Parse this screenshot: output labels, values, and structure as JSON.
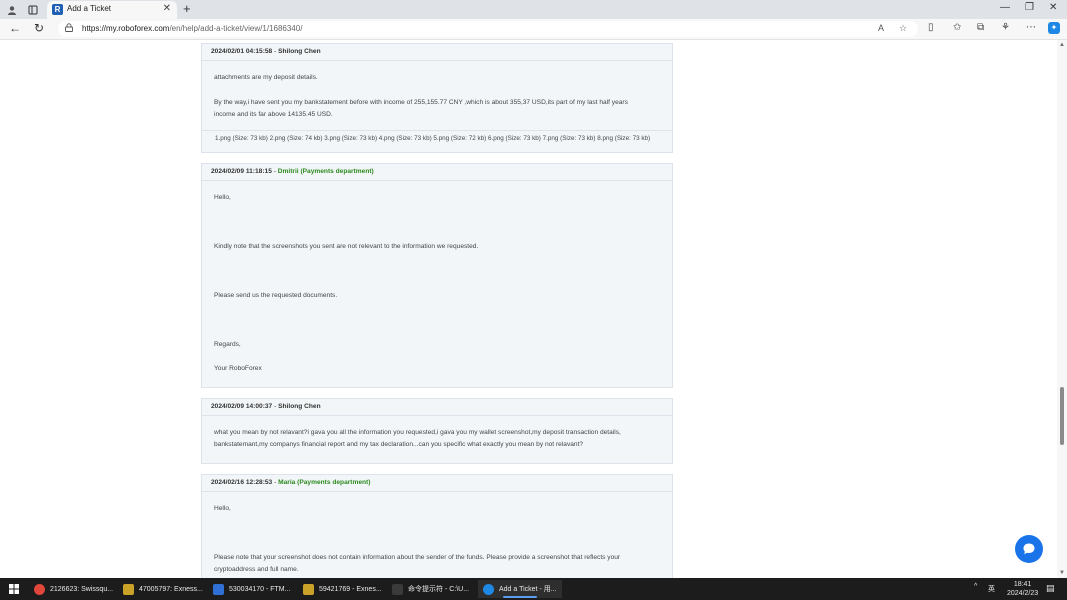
{
  "browser": {
    "tab_title": "Add a Ticket",
    "url_host": "https://my.roboforex.com",
    "url_path": "/en/help/add-a-ticket/view/1/1686340/"
  },
  "messages": [
    {
      "date": "2024/02/01 04:15:58",
      "sep": " - ",
      "author": "Shilong Chen",
      "staff": false,
      "lines": [
        "attachments are my deposit details.",
        "By the way,i have sent you my bankstatement before with income of 255,155.77 CNY ,which is about 355,37 USD,its part of my last half years",
        "income and its far above 14135.45 USD."
      ],
      "attachments": "1.png (Size: 73 kb) 2.png (Size: 74 kb) 3.png (Size: 73 kb) 4.png (Size: 73 kb) 5.png (Size: 72 kb) 6.png (Size: 73 kb) 7.png (Size: 73 kb) 8.png (Size: 73 kb)"
    },
    {
      "date": "2024/02/09 11:18:15",
      "sep": " - ",
      "author": "Dmitrii (Payments department)",
      "staff": true,
      "lines": [
        "Hello,",
        "Kindly note that the screenshots you sent are not relevant to the information we requested.",
        "Please send us the requested documents.",
        "Regards,",
        "Your RoboForex"
      ]
    },
    {
      "date": "2024/02/09 14:00:37",
      "sep": " - ",
      "author": "Shilong Chen",
      "staff": false,
      "lines": [
        "what you mean by not relavant?i gava you all the information you requested,i gava you my wallet screenshot,my deposit transaction details,",
        "bankstatemant,my companys financial report and my tax declaration...can you specific what exactly you mean by not relavant?"
      ]
    },
    {
      "date": "2024/02/16 12:28:53",
      "sep": " - ",
      "author": "Maria (Payments department)",
      "staff": true,
      "lines": [
        "Hello,",
        "Please note that your screenshot does not contain information about the sender of the funds. Please provide a screenshot that reflects your",
        "cryptoaddress and full name."
      ]
    }
  ],
  "taskbar": {
    "items": [
      {
        "label": "2126623: Swissqu...",
        "icon_color": "#e0463a"
      },
      {
        "label": "47005797: Exness...",
        "icon_color": "#c9a227"
      },
      {
        "label": "530034170 - FTM...",
        "icon_color": "#2f6fd6"
      },
      {
        "label": "59421769 - Exnes...",
        "icon_color": "#c9a227"
      },
      {
        "label": "命令提示符 - C:\\U...",
        "icon_color": "#3a3a3a"
      },
      {
        "label": "Add a Ticket - 用...",
        "icon_color": "#1e88e5"
      }
    ],
    "ime": "英",
    "time": "18:41",
    "date": "2024/2/23"
  },
  "colors": {
    "staff_name": "#2b8a1e",
    "accent": "#1a73e8"
  }
}
